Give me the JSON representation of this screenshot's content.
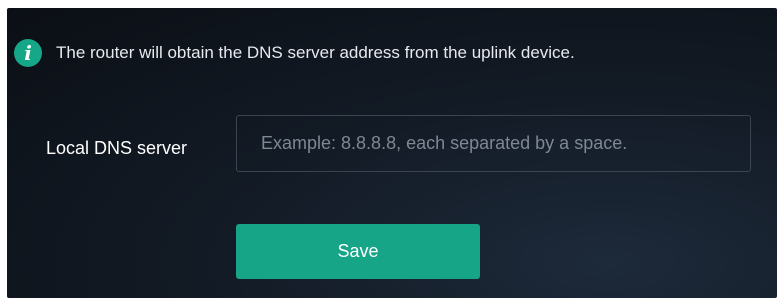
{
  "info": {
    "icon": "info-icon",
    "icon_glyph": "i",
    "text": "The router will obtain the DNS server address from the uplink device."
  },
  "dns_field": {
    "label": "Local DNS server",
    "value": "",
    "placeholder": "Example: 8.8.8.8, each separated by a space."
  },
  "actions": {
    "save_label": "Save"
  },
  "colors": {
    "accent": "#17a588",
    "background": "#0f151d",
    "text": "#e6e9ee",
    "placeholder": "#7e8794"
  }
}
